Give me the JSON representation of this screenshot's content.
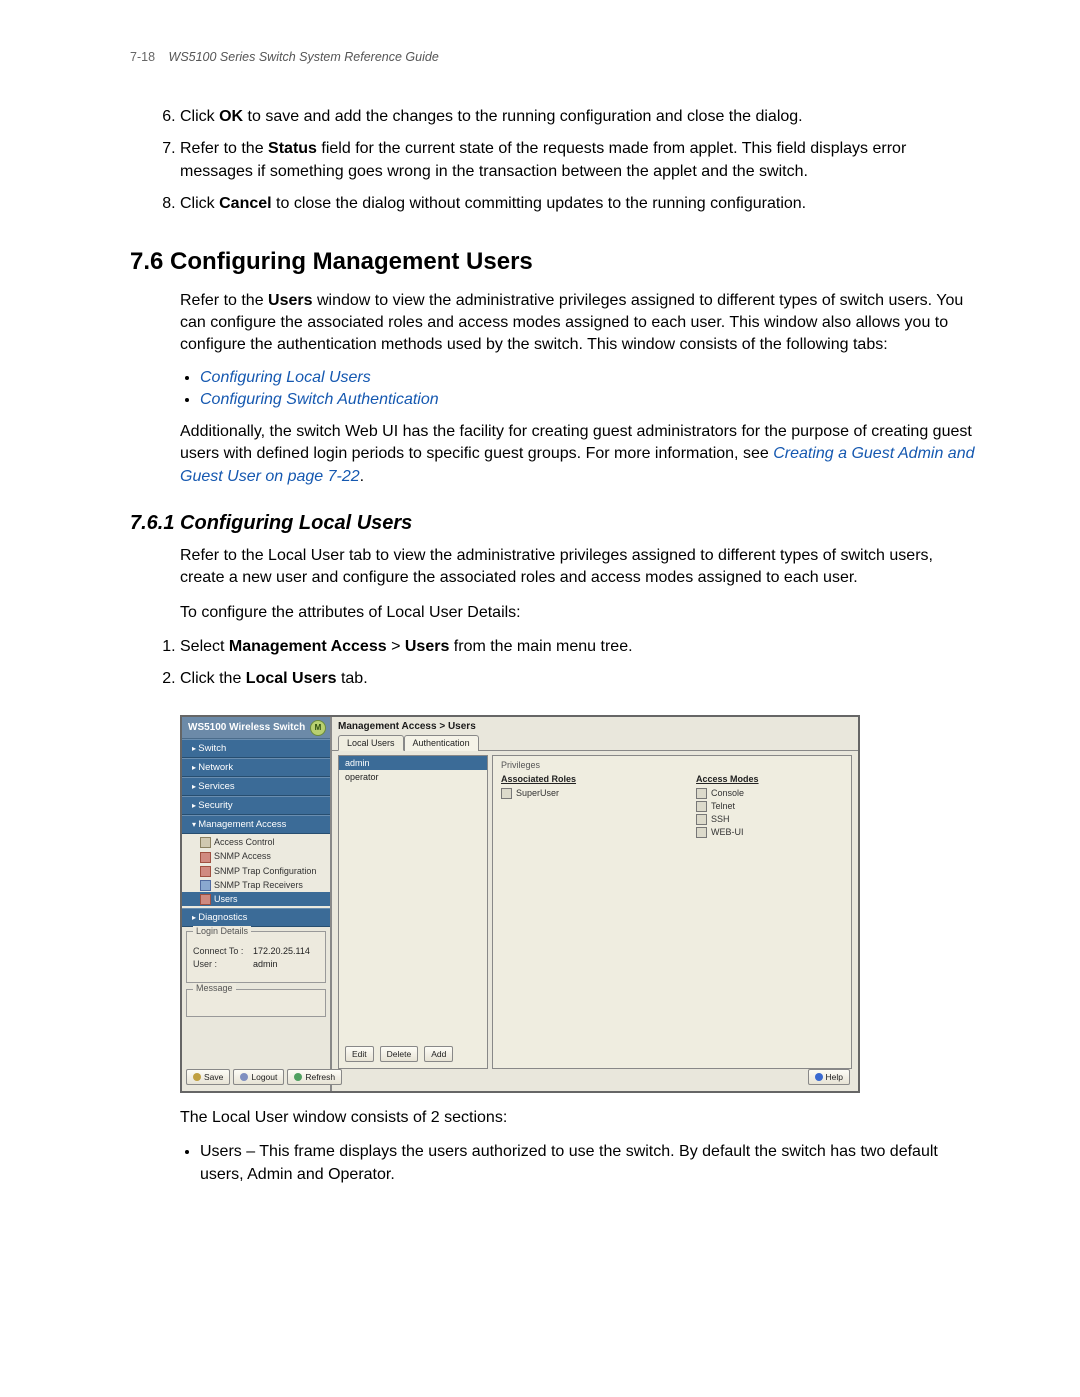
{
  "header": {
    "page_label": "7-18",
    "guide_title": "WS5100 Series Switch System Reference Guide"
  },
  "steps_a": {
    "start": 6,
    "items": [
      {
        "pre": "Click ",
        "bold": "OK",
        "post": " to save and add the changes to the running configuration and close the dialog."
      },
      {
        "pre": "Refer to the ",
        "bold": "Status",
        "post": " field for the current state of the requests made from applet. This field displays error messages if something goes wrong in the transaction between the applet and the switch."
      },
      {
        "pre": "Click ",
        "bold": "Cancel",
        "post": " to close the dialog without committing updates to the running configuration."
      }
    ]
  },
  "section": {
    "num": "7.6",
    "title": "Configuring Management Users"
  },
  "para1": "Refer to the Users window to view the administrative privileges assigned to different types of switch users. You can configure the associated roles and access modes assigned to each user. This window also allows you to configure the authentication methods used by the switch. This window consists of the following tabs:",
  "links": {
    "a": "Configuring Local Users",
    "b": "Configuring Switch Authentication"
  },
  "para2_pre": "Additionally, the switch Web UI has the facility for creating guest administrators for the purpose of creating guest users with defined login periods to specific guest groups. For more information, see ",
  "para2_link": "Creating a Guest Admin and Guest User on page 7-22",
  "para2_post": ".",
  "subsection": {
    "num": "7.6.1",
    "title": "Configuring Local Users"
  },
  "para3": "Refer to the Local User tab to view the administrative privileges assigned to different types of switch users, create a new user and configure the associated roles and access modes assigned to each user.",
  "para4": "To configure the attributes of Local User Details:",
  "steps_b": {
    "start": 1,
    "items": [
      {
        "pre": "Select ",
        "bold": "Management Access",
        "mid": " > ",
        "bold2": "Users",
        "post": " from the main menu tree."
      },
      {
        "pre": "Click the ",
        "bold": "Local Users",
        "post": " tab."
      }
    ]
  },
  "figure": {
    "product": "WS5100 Wireless Switch",
    "nav": {
      "switch": "Switch",
      "network": "Network",
      "services": "Services",
      "security": "Security",
      "mgmt": "Management Access",
      "mgmt_children": [
        {
          "icon": "plain",
          "label": "Access Control"
        },
        {
          "icon": "red",
          "label": "SNMP Access"
        },
        {
          "icon": "red",
          "label": "SNMP Trap Configuration"
        },
        {
          "icon": "blue",
          "label": "SNMP Trap Receivers"
        },
        {
          "icon": "red",
          "label": "Users",
          "selected": true
        }
      ],
      "diagnostics": "Diagnostics"
    },
    "login": {
      "title": "Login Details",
      "connect_label": "Connect To :",
      "connect_value": "172.20.25.114",
      "user_label": "User :",
      "user_value": "admin"
    },
    "message_title": "Message",
    "buttons": {
      "save": "Save",
      "logout": "Logout",
      "refresh": "Refresh",
      "edit": "Edit",
      "delete": "Delete",
      "add": "Add",
      "help": "Help"
    },
    "crumb": "Management Access > Users",
    "tabs": {
      "local": "Local Users",
      "auth": "Authentication"
    },
    "userlist": [
      "admin",
      "operator"
    ],
    "priv": {
      "header": "Privileges",
      "roles_hdr": "Associated Roles",
      "roles": [
        "SuperUser"
      ],
      "modes_hdr": "Access Modes",
      "modes": [
        "Console",
        "Telnet",
        "SSH",
        "WEB-UI"
      ]
    }
  },
  "after_fig": "The Local User window consists of 2 sections:",
  "bullet1": "Users – This frame displays the users authorized to use the switch. By default the switch has two default users, Admin and Operator."
}
